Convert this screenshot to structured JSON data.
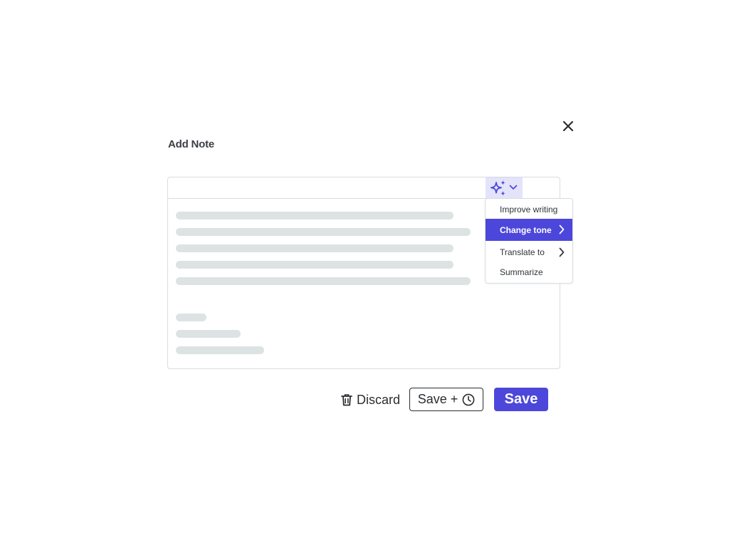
{
  "dialog": {
    "title": "Add Note",
    "close_icon": "close-icon"
  },
  "editor": {
    "ai_icon": "sparkles-icon",
    "dropdown_icon": "chevron-down-icon",
    "content_state": "loading"
  },
  "ai_menu": {
    "items": [
      {
        "label": "Improve writing",
        "has_submenu": false,
        "active": false
      },
      {
        "label": "Change tone",
        "has_submenu": true,
        "active": true
      },
      {
        "label": "Translate to",
        "has_submenu": true,
        "active": false
      },
      {
        "label": "Summarize",
        "has_submenu": false,
        "active": false
      }
    ]
  },
  "footer": {
    "discard_label": "Discard",
    "discard_icon": "trash-icon",
    "save_schedule_label": "Save +",
    "schedule_icon": "clock-icon",
    "save_label": "Save"
  },
  "colors": {
    "accent": "#4c47da",
    "accent_light": "#e3e3fb",
    "skeleton": "#dde3e3",
    "border": "#d8dcdf"
  }
}
